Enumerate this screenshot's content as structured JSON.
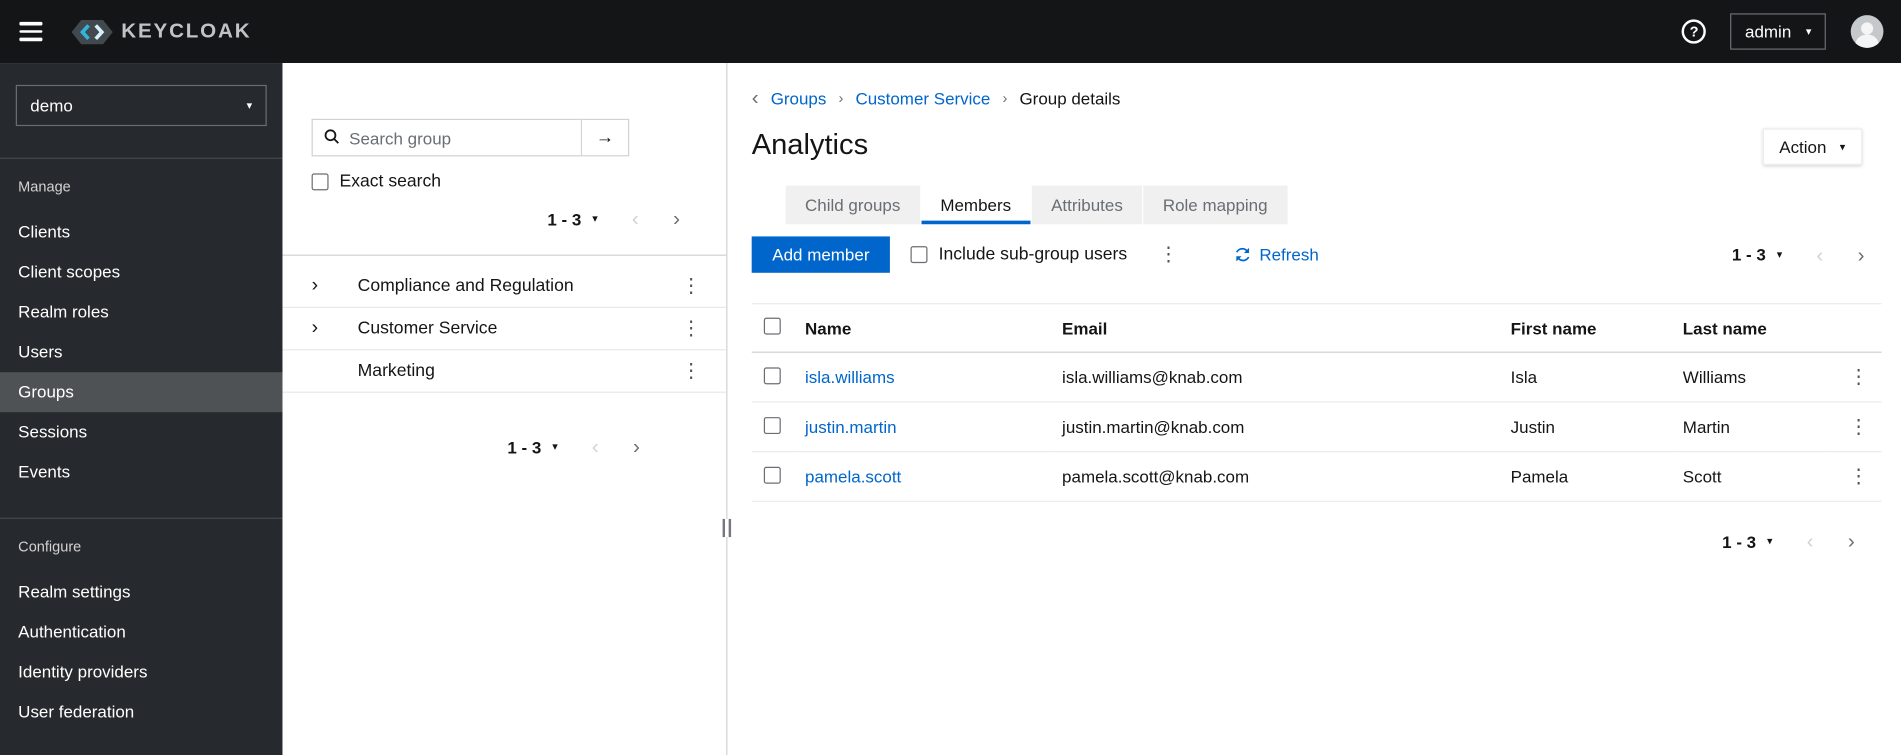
{
  "masthead": {
    "brand": "KEYCLOAK",
    "help_label": "?",
    "user": "admin"
  },
  "icons": {
    "caret_down": "▾",
    "chevron_left": "‹",
    "chevron_right": "›",
    "kebab": "⋮",
    "breadcrumb_separator": "›",
    "back_arrow": "‹",
    "arrow_right": "→",
    "expand_chevron": "›",
    "search": "magnifying-glass",
    "refresh": "sync-arrows",
    "avatar": "person-silhouette",
    "hamburger": "menu-bars"
  },
  "sidebar": {
    "realm": "demo",
    "manage": {
      "label": "Manage",
      "items": [
        "Clients",
        "Client scopes",
        "Realm roles",
        "Users",
        "Groups",
        "Sessions",
        "Events"
      ]
    },
    "configure": {
      "label": "Configure",
      "items": [
        "Realm settings",
        "Authentication",
        "Identity providers",
        "User federation"
      ]
    },
    "selected_item": "Groups"
  },
  "groups_panel": {
    "search_placeholder": "Search group",
    "exact_search_label": "Exact search",
    "top_pagination": {
      "range": "1 - 3"
    },
    "tree": [
      {
        "label": "Compliance and Regulation",
        "expandable": true
      },
      {
        "label": "Customer Service",
        "expandable": true
      },
      {
        "label": "Marketing",
        "expandable": false
      }
    ],
    "bottom_pagination": {
      "range": "1 - 3"
    }
  },
  "main": {
    "breadcrumb": {
      "links": [
        "Groups",
        "Customer Service"
      ],
      "current": "Group details"
    },
    "title": "Analytics",
    "action_label": "Action",
    "tabs": [
      "Child groups",
      "Members",
      "Attributes",
      "Role mapping"
    ],
    "active_tab": "Members",
    "toolbar": {
      "add_member_label": "Add member",
      "include_subgroups_label": "Include sub-group users",
      "refresh_label": "Refresh",
      "pagination": {
        "range": "1 - 3"
      }
    },
    "table": {
      "headers": {
        "name": "Name",
        "email": "Email",
        "first_name": "First name",
        "last_name": "Last name"
      },
      "rows": [
        {
          "username": "isla.williams",
          "email": "isla.williams@knab.com",
          "first_name": "Isla",
          "last_name": "Williams"
        },
        {
          "username": "justin.martin",
          "email": "justin.martin@knab.com",
          "first_name": "Justin",
          "last_name": "Martin"
        },
        {
          "username": "pamela.scott",
          "email": "pamela.scott@knab.com",
          "first_name": "Pamela",
          "last_name": "Scott"
        }
      ]
    },
    "bottom_pagination": {
      "range": "1 - 3"
    }
  },
  "colors": {
    "primary_blue": "#0066cc",
    "masthead_bg": "#131517",
    "sidebar_bg": "#26292d",
    "sidebar_selected_bg": "#4f5255",
    "inactive_tab_bg": "#f0f0f0"
  }
}
